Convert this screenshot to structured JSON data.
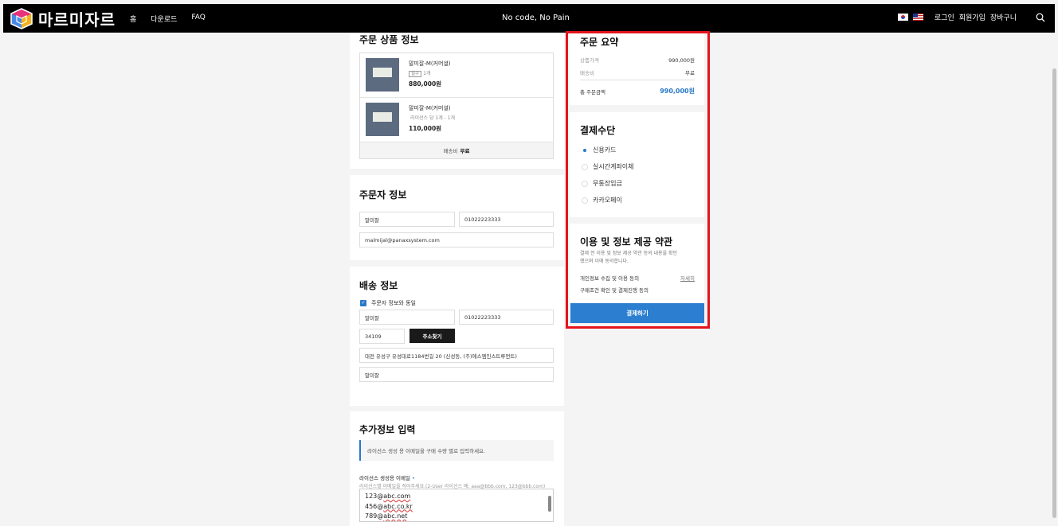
{
  "header": {
    "logo_text": "마르미자르",
    "nav": [
      "홈",
      "다운로드",
      "FAQ"
    ],
    "slogan": "No code, No Pain",
    "login": "로그인",
    "signup": "회원가입",
    "cart": "장바구니"
  },
  "order_products": {
    "title": "주문 상품 정보",
    "items": [
      {
        "name": "말미잘-M(커머셜)",
        "badge": "필수",
        "option": "1개",
        "price": "880,000원"
      },
      {
        "name": "말미잘-M(커머셜)",
        "badge": "",
        "option": "라이선스 당 1개 - 1개",
        "price": "110,000원"
      }
    ],
    "shipping_label": "배송비",
    "shipping_value": "무료"
  },
  "orderer": {
    "title": "주문자 정보",
    "name": "말미잘",
    "phone": "01022223333",
    "email": "malmijal@panaxsystem.com"
  },
  "delivery": {
    "title": "배송 정보",
    "same_label": "주문자 정보와 동일",
    "name": "말미잘",
    "phone": "01022223333",
    "postcode": "34109",
    "find_address": "주소찾기",
    "address": "대전 유성구 유성대로1184번길 20 (신성동, (주)에스엠인스트루먼트)",
    "address_detail": "말미잘"
  },
  "extra": {
    "title": "추가정보 입력",
    "notice": "라이선스 생성 용 이메일을 구매 수량 별로 입력하세요.",
    "field_label": "라이선스 생성용 이메일",
    "required_mark": "•",
    "hint": "라이선스별 이메일을 적어주세요.(2-User 라이선스 예: aaa@bbb.com, 123@bbb.com)",
    "emails": [
      {
        "prefix": "123@",
        "domain": "abc.com"
      },
      {
        "prefix": "456@",
        "domain": "abc.co.kr"
      },
      {
        "prefix": "789@",
        "domain": "abc.net"
      }
    ]
  },
  "summary": {
    "title": "주문 요약",
    "product_label": "상품가격",
    "product_value": "990,000원",
    "shipping_label": "배송비",
    "shipping_value": "무료",
    "total_label": "총 주문금액",
    "total_value": "990,000원"
  },
  "payment": {
    "title": "결제수단",
    "methods": [
      "신용카드",
      "실시간계좌이체",
      "무통장입금",
      "카카오페이"
    ],
    "selected": "신용카드"
  },
  "terms": {
    "title": "이용 및 정보 제공 약관",
    "desc_line1": "결제 전 이용 및 정보 제공 약관 등의 내용을 확인",
    "desc_line2": "했으며 이에 동의합니다.",
    "privacy": "개인정보 수집 및 이용 동의",
    "detail": "자세히",
    "purchase": "구매조건 확인 및 결제진행 동의"
  },
  "pay_button": "결제하기",
  "colors": {
    "accent": "#2b7ed0",
    "highlight": "#e3141c",
    "header_bg": "#000000"
  }
}
